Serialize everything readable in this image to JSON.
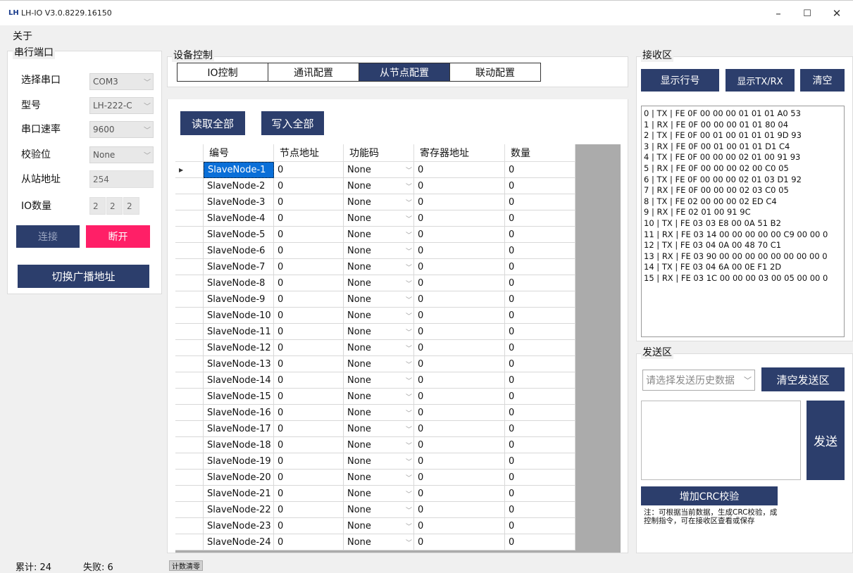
{
  "window": {
    "logo": "LH",
    "title": "LH-IO V3.0.8229.16150",
    "minimize": "–",
    "maximize": "☐",
    "close": "✕"
  },
  "menu": {
    "about": "关于"
  },
  "serial": {
    "legend": "串行端口",
    "port_label": "选择串口",
    "port_value": "COM3",
    "model_label": "型号",
    "model_value": "LH-222-C",
    "baud_label": "串口速率",
    "baud_value": "9600",
    "parity_label": "校验位",
    "parity_value": "None",
    "slave_label": "从站地址",
    "slave_value": "254",
    "io_label": "IO数量",
    "io_values": [
      "2",
      "2",
      "2"
    ],
    "connect": "连接",
    "disconnect": "断开",
    "broadcast": "切换广播地址"
  },
  "device": {
    "legend": "设备控制",
    "tabs": [
      "IO控制",
      "通讯配置",
      "从节点配置",
      "联动配置"
    ],
    "active_tab": 2,
    "read_all": "读取全部",
    "write_all": "写入全部"
  },
  "grid": {
    "headers": [
      "编号",
      "节点地址",
      "功能码",
      "寄存器地址",
      "数量"
    ],
    "rows": [
      {
        "name": "SlaveNode-1",
        "addr": "0",
        "func": "None",
        "reg": "0",
        "qty": "0"
      },
      {
        "name": "SlaveNode-2",
        "addr": "0",
        "func": "None",
        "reg": "0",
        "qty": "0"
      },
      {
        "name": "SlaveNode-3",
        "addr": "0",
        "func": "None",
        "reg": "0",
        "qty": "0"
      },
      {
        "name": "SlaveNode-4",
        "addr": "0",
        "func": "None",
        "reg": "0",
        "qty": "0"
      },
      {
        "name": "SlaveNode-5",
        "addr": "0",
        "func": "None",
        "reg": "0",
        "qty": "0"
      },
      {
        "name": "SlaveNode-6",
        "addr": "0",
        "func": "None",
        "reg": "0",
        "qty": "0"
      },
      {
        "name": "SlaveNode-7",
        "addr": "0",
        "func": "None",
        "reg": "0",
        "qty": "0"
      },
      {
        "name": "SlaveNode-8",
        "addr": "0",
        "func": "None",
        "reg": "0",
        "qty": "0"
      },
      {
        "name": "SlaveNode-9",
        "addr": "0",
        "func": "None",
        "reg": "0",
        "qty": "0"
      },
      {
        "name": "SlaveNode-10",
        "addr": "0",
        "func": "None",
        "reg": "0",
        "qty": "0"
      },
      {
        "name": "SlaveNode-11",
        "addr": "0",
        "func": "None",
        "reg": "0",
        "qty": "0"
      },
      {
        "name": "SlaveNode-12",
        "addr": "0",
        "func": "None",
        "reg": "0",
        "qty": "0"
      },
      {
        "name": "SlaveNode-13",
        "addr": "0",
        "func": "None",
        "reg": "0",
        "qty": "0"
      },
      {
        "name": "SlaveNode-14",
        "addr": "0",
        "func": "None",
        "reg": "0",
        "qty": "0"
      },
      {
        "name": "SlaveNode-15",
        "addr": "0",
        "func": "None",
        "reg": "0",
        "qty": "0"
      },
      {
        "name": "SlaveNode-16",
        "addr": "0",
        "func": "None",
        "reg": "0",
        "qty": "0"
      },
      {
        "name": "SlaveNode-17",
        "addr": "0",
        "func": "None",
        "reg": "0",
        "qty": "0"
      },
      {
        "name": "SlaveNode-18",
        "addr": "0",
        "func": "None",
        "reg": "0",
        "qty": "0"
      },
      {
        "name": "SlaveNode-19",
        "addr": "0",
        "func": "None",
        "reg": "0",
        "qty": "0"
      },
      {
        "name": "SlaveNode-20",
        "addr": "0",
        "func": "None",
        "reg": "0",
        "qty": "0"
      },
      {
        "name": "SlaveNode-21",
        "addr": "0",
        "func": "None",
        "reg": "0",
        "qty": "0"
      },
      {
        "name": "SlaveNode-22",
        "addr": "0",
        "func": "None",
        "reg": "0",
        "qty": "0"
      },
      {
        "name": "SlaveNode-23",
        "addr": "0",
        "func": "None",
        "reg": "0",
        "qty": "0"
      },
      {
        "name": "SlaveNode-24",
        "addr": "0",
        "func": "None",
        "reg": "0",
        "qty": "0"
      }
    ]
  },
  "receive": {
    "legend": "接收区",
    "show_line_no": "显示行号",
    "show_txrx": "显示TX/RX",
    "clear": "清空",
    "lines": [
      "0 | TX | FE 0F 00 00 00 01 01 01 A0 53",
      "1 | RX | FE 0F 00 00 00 01 01 80 04",
      "2 | TX | FE 0F 00 01 00 01 01 01 9D 93",
      "3 | RX | FE 0F 00 01 00 01 01 D1 C4",
      "4 | TX | FE 0F 00 00 00 02 01 00 91 93",
      "5 | RX | FE 0F 00 00 00 02 00 C0 05",
      "6 | TX | FE 0F 00 00 00 02 01 03 D1 92",
      "7 | RX | FE 0F 00 00 00 02 03 C0 05",
      "8 | TX | FE 02 00 00 00 02 ED C4",
      "9 | RX | FE 02 01 00 91 9C",
      "10 | TX | FE 03 03 E8 00 0A 51 B2",
      "11 | RX | FE 03 14 00 00 00 00 00 C9 00 00 0",
      "12 | TX | FE 03 04 0A 00 48 70 C1",
      "13 | RX | FE 03 90 00 00 00 00 00 00 00 00 0",
      "14 | TX | FE 03 04 6A 00 0E F1 2D",
      "15 | RX | FE 03 1C 00 00 00 03 00 05 00 00 0"
    ]
  },
  "send": {
    "legend": "发送区",
    "history_placeholder": "请选择发送历史数据",
    "clear_send": "清空发送区",
    "send": "发送",
    "add_crc": "增加CRC校验",
    "note_line1": "注：可根据当前数据，生成CRC校验，成",
    "note_line2": "控制指令，可在接收区查看或保存"
  },
  "status": {
    "total": "累计: 24",
    "failed": "失败: 6",
    "reset": "计数清零"
  },
  "colors": {
    "accent": "#2c3e6c",
    "danger": "#ff1f67",
    "selection": "#0a6fd8"
  }
}
